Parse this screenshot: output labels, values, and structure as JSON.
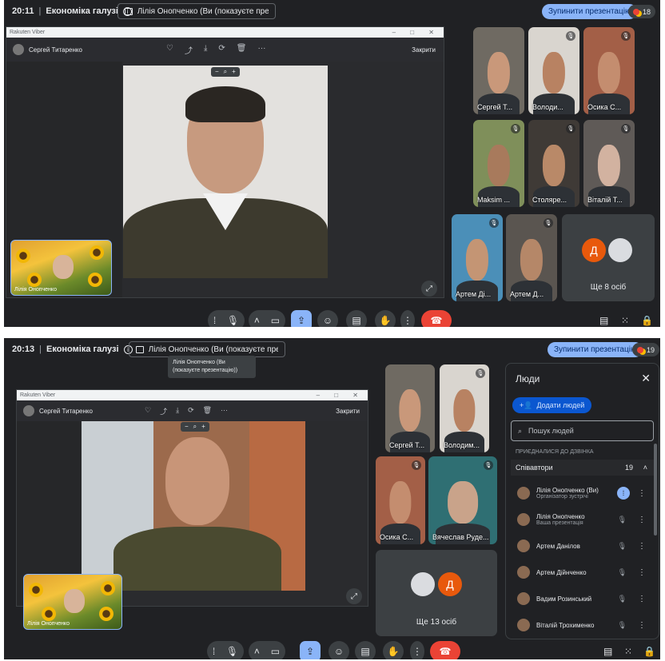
{
  "s1": {
    "time": "20:11",
    "title": "Економіка галузі",
    "present": "Лілія Онопченко (Ви (показуєте презентацію))",
    "stop": "Зупинити презентацію",
    "count": "18",
    "viber": {
      "title": "Rakuten Viber",
      "contact": "Сергей Титаренко",
      "close": "Закрити"
    },
    "self": "Лілія Онопченко",
    "tiles": [
      {
        "name": "Сергей Т...",
        "skin": "#c9987a",
        "bg": "#6f6a62"
      },
      {
        "name": "Володи...",
        "skin": "#b88262",
        "bg": "#d9d5cf"
      },
      {
        "name": "Осика С...",
        "skin": "#c48d6f",
        "bg": "#a35f47"
      },
      {
        "name": "Maksim ...",
        "skin": "#a87a5c",
        "bg": "#7f8f5a"
      },
      {
        "name": "Столяре...",
        "skin": "#b98968",
        "bg": "#3f3a36"
      },
      {
        "name": "Віталій Т...",
        "skin": "#d2b2a0",
        "bg": "#5f5a57"
      },
      {
        "name": "Артем Ді...",
        "skin": "#c49574",
        "bg": "#4b8fb8"
      },
      {
        "name": "Артем Д...",
        "skin": "#b58768",
        "bg": "#5a5550"
      }
    ],
    "more_label": "Ще 8 осіб",
    "av_letter": "Д"
  },
  "s2": {
    "time": "20:13",
    "title": "Економіка галузі",
    "present": "Лілія Онопченко (Ви (показуєте презентацію))",
    "tooltip": "Лілія Онопченко (Ви (показуєте презентацію))",
    "stop": "Зупинити презентацію",
    "count": "19",
    "viber": {
      "title": "Rakuten Viber",
      "contact": "Сергей Титаренко",
      "close": "Закрити"
    },
    "self": "Лілія Онопченко",
    "tiles": [
      {
        "name": "Сергей Т...",
        "skin": "#c9987a",
        "bg": "#6f6a62"
      },
      {
        "name": "Володим...",
        "skin": "#b88262",
        "bg": "#d9d5cf"
      },
      {
        "name": "Осика С...",
        "skin": "#c48d6f",
        "bg": "#a35f47"
      },
      {
        "name": "Вячеслав Руде...",
        "skin": "#c9a38a",
        "bg": "#2f6f73"
      }
    ],
    "more_label": "Ще 13 осіб",
    "av_letter": "Д",
    "people": {
      "title": "Люди",
      "add": "Додати людей",
      "search_placeholder": "Пошук людей",
      "section": "ПРИЄДНАЛИСЯ ДО ДЗВІНКА",
      "group": "Співавтори",
      "group_count": "19",
      "rows": [
        {
          "name": "Лілія Онопченко (Ви)",
          "sub": "Організатор зустрічі"
        },
        {
          "name": "Лілія Онопченко",
          "sub": "Ваша презентація"
        },
        {
          "name": "Артем Данілов",
          "sub": ""
        },
        {
          "name": "Артем Дійнченко",
          "sub": ""
        },
        {
          "name": "Вадим Розинський",
          "sub": ""
        },
        {
          "name": "Віталій Трохименко",
          "sub": ""
        }
      ]
    }
  },
  "colors": {
    "bg": "#202124",
    "accent": "#8ab4f8",
    "end": "#ea4335",
    "orange_avatar": "#e8590c"
  }
}
